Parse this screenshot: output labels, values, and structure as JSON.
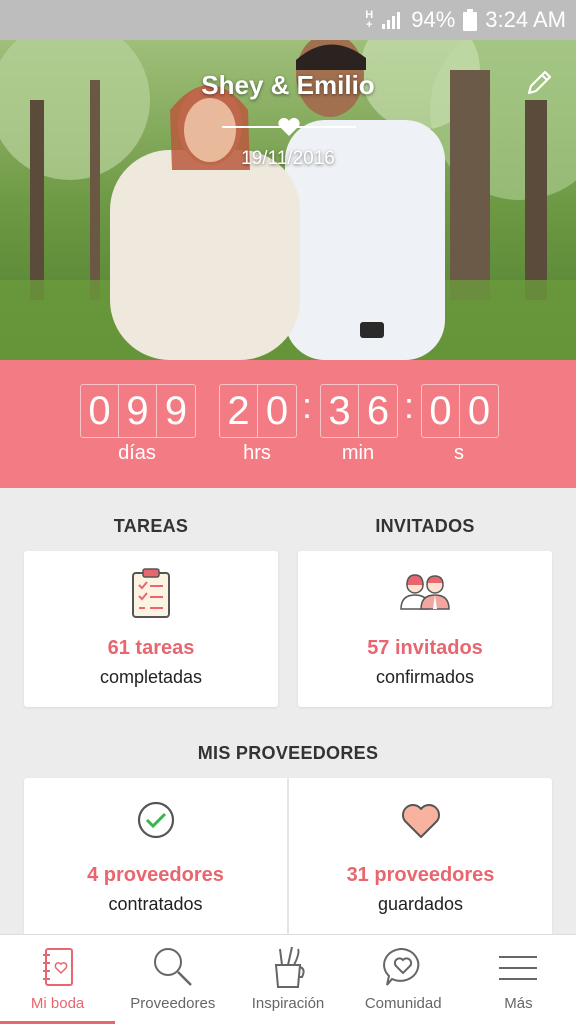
{
  "status_bar": {
    "network": "H",
    "network_plus": "+",
    "battery": "94%",
    "time": "3:24 AM"
  },
  "hero": {
    "couple_name": "Shey & Emilio",
    "date": "19/11/2016"
  },
  "countdown": {
    "days_digits": [
      "0",
      "9",
      "9"
    ],
    "hours_digits": [
      "2",
      "0"
    ],
    "minutes_digits": [
      "3",
      "6"
    ],
    "seconds_digits": [
      "0",
      "0"
    ],
    "separator": ":",
    "labels": {
      "days": "días",
      "hours": "hrs",
      "minutes": "min",
      "seconds": "s"
    }
  },
  "tasks": {
    "title": "TAREAS",
    "count": "61 tareas",
    "subtitle": "completadas"
  },
  "guests": {
    "title": "INVITADOS",
    "count": "57 invitados",
    "subtitle": "confirmados"
  },
  "vendors": {
    "title": "MIS PROVEEDORES",
    "hired": {
      "count": "4 proveedores",
      "subtitle": "contratados"
    },
    "saved": {
      "count": "31 proveedores",
      "subtitle": "guardados"
    }
  },
  "nav": [
    {
      "label": "Mi boda",
      "icon": "notebook-icon",
      "active": true
    },
    {
      "label": "Proveedores",
      "icon": "search-icon"
    },
    {
      "label": "Inspiración",
      "icon": "pencil-cup-icon"
    },
    {
      "label": "Comunidad",
      "icon": "chat-heart-icon"
    },
    {
      "label": "Más",
      "icon": "menu-icon"
    }
  ],
  "colors": {
    "accent": "#e8666f",
    "countdown_bg": "#f37b83",
    "status_bar": "#bdbdbd"
  }
}
